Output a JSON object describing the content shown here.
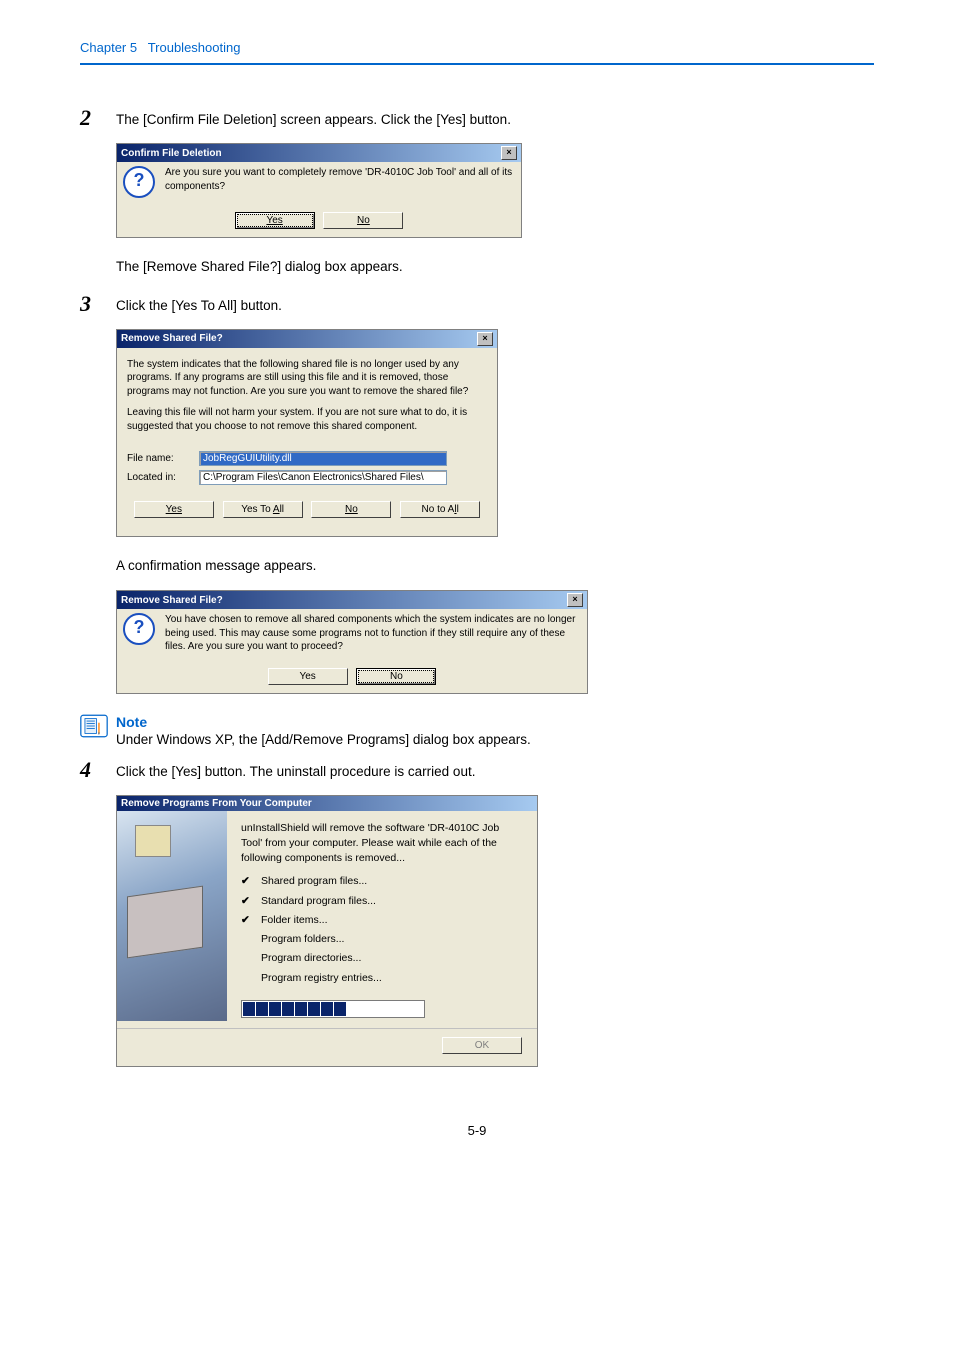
{
  "header": {
    "chapter": "Chapter 5",
    "title": "Troubleshooting"
  },
  "step2": {
    "num": "2",
    "text": "The [Confirm File Deletion] screen appears. Click the [Yes] button.",
    "after": "The [Remove Shared File?] dialog box appears."
  },
  "step3": {
    "num": "3",
    "text": "Click the [Yes To All] button.",
    "after": "A confirmation message appears."
  },
  "dlg_confirm": {
    "title": "Confirm File Deletion",
    "msg": "Are you sure you want to completely remove 'DR-4010C Job Tool' and all of its components?",
    "yes": "Yes",
    "no": "No"
  },
  "dlg_shared": {
    "title": "Remove Shared File?",
    "p1": "The system indicates that the following shared file is no longer used by any programs. If any programs are still using this file and it is removed, those programs may not function. Are you sure you want to remove the shared file?",
    "p2": "Leaving this file will not harm your system. If you are not sure what to do, it is suggested that you choose to not remove this shared component.",
    "file_label": "File name:",
    "file_value": "JobRegGUIUtility.dll",
    "loc_label": "Located in:",
    "loc_value": "C:\\Program Files\\Canon Electronics\\Shared Files\\",
    "yes": "Yes",
    "yes_all": "Yes To All",
    "yes_all_u": "A",
    "no": "No",
    "no_all": "No to All",
    "no_all_u": "l"
  },
  "dlg_shared2": {
    "title": "Remove Shared File?",
    "msg": "You have chosen to remove all shared components which the system indicates are no longer being used. This may cause some programs not to function if they still require any of these files. Are you sure you want to proceed?",
    "yes": "Yes",
    "no": "No"
  },
  "note": {
    "title": "Note",
    "text": "Under Windows XP, the [Add/Remove Programs] dialog box appears."
  },
  "step4": {
    "num": "4",
    "text": "Click the [Yes] button. The uninstall procedure is carried out."
  },
  "dlg_remove": {
    "title": "Remove Programs From Your Computer",
    "lead": "unInstallShield will remove the software 'DR-4010C Job Tool' from your computer. Please wait while each of the following components is removed...",
    "items": [
      "Shared program files...",
      "Standard program files...",
      "Folder items...",
      "Program folders...",
      "Program directories...",
      "Program registry entries..."
    ],
    "checked": [
      true,
      true,
      true,
      false,
      false,
      false
    ],
    "ok": "OK"
  },
  "page_num": "5-9"
}
